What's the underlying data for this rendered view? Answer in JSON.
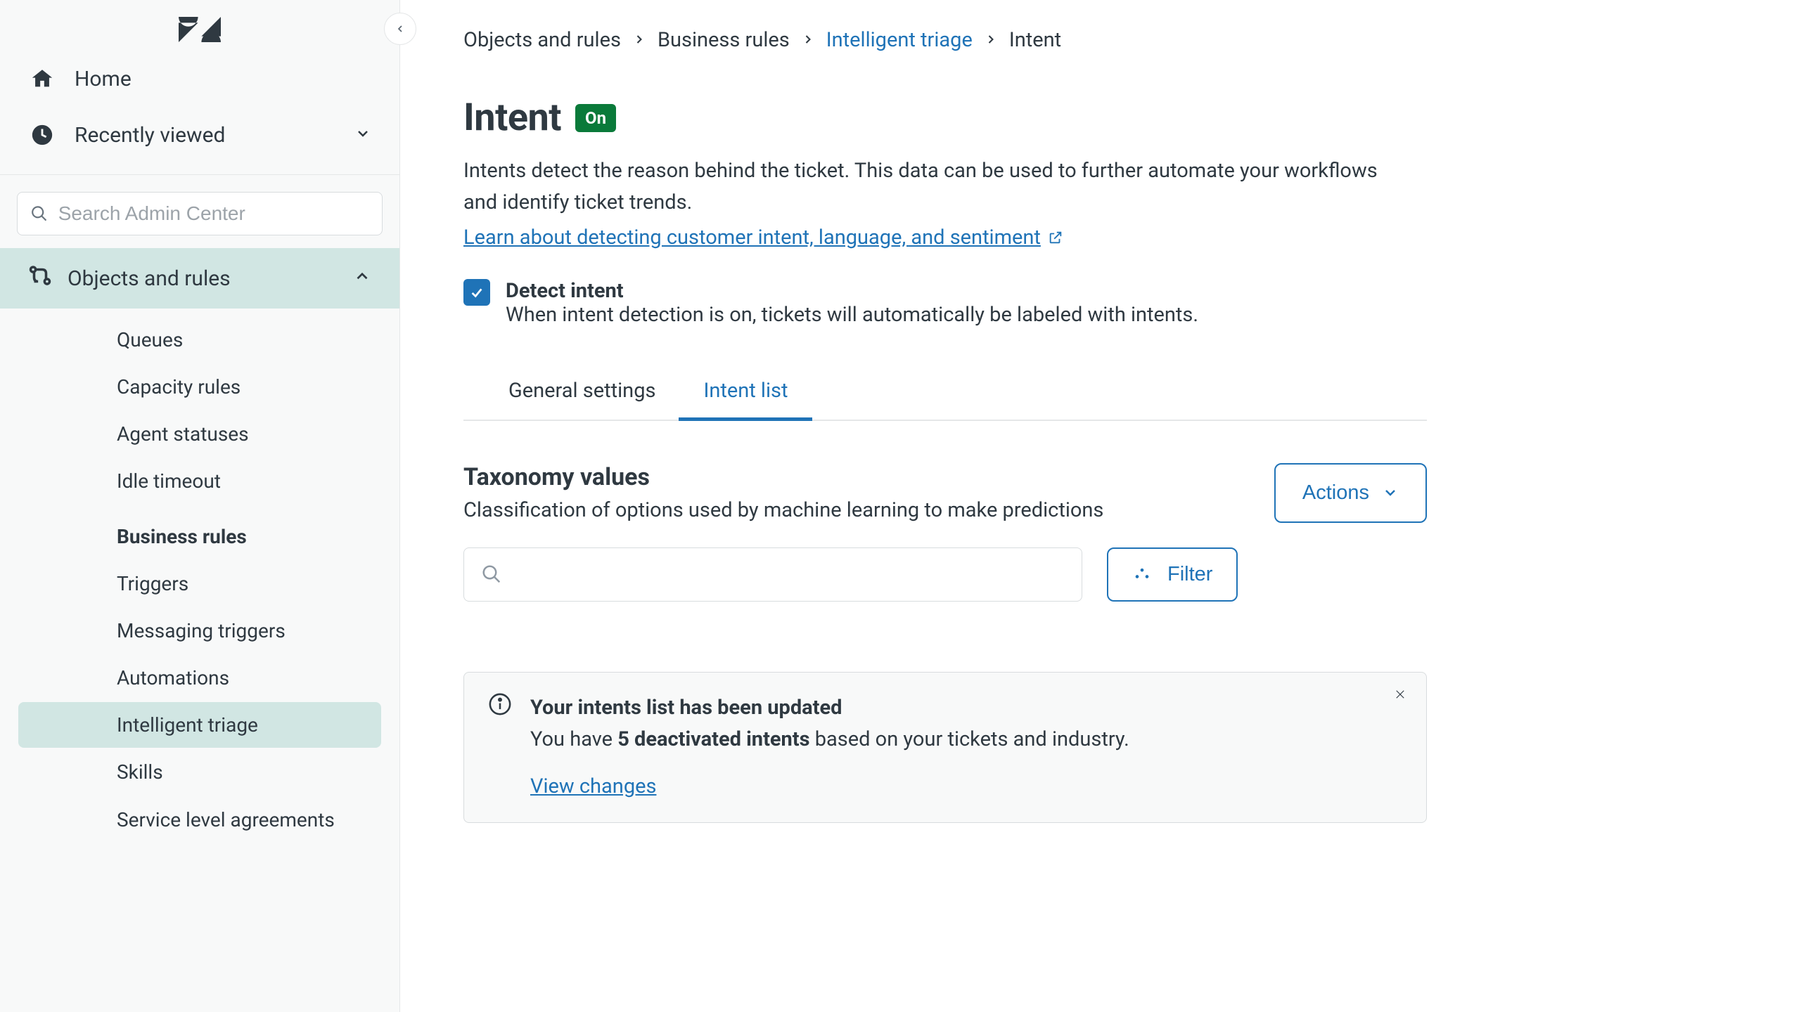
{
  "sidebar": {
    "home_label": "Home",
    "recent_label": "Recently viewed",
    "search_placeholder": "Search Admin Center",
    "section_label": "Objects and rules",
    "items": [
      {
        "label": "Queues"
      },
      {
        "label": "Capacity rules"
      },
      {
        "label": "Agent statuses"
      },
      {
        "label": "Idle timeout"
      }
    ],
    "group_header": "Business rules",
    "group_items": [
      {
        "label": "Triggers"
      },
      {
        "label": "Messaging triggers"
      },
      {
        "label": "Automations"
      },
      {
        "label": "Intelligent triage",
        "active": true
      },
      {
        "label": "Skills"
      },
      {
        "label": "Service level agreements"
      }
    ]
  },
  "breadcrumb": {
    "items": [
      "Objects and rules",
      "Business rules",
      "Intelligent triage",
      "Intent"
    ],
    "link_index": 2
  },
  "page": {
    "title": "Intent",
    "status": "On",
    "description": "Intents detect the reason behind the ticket. This data can be used to further automate your workflows and identify ticket trends.",
    "learn_link": "Learn about detecting customer intent, language, and sentiment"
  },
  "detect": {
    "label": "Detect intent",
    "sub": "When intent detection is on, tickets will automatically be labeled with intents.",
    "checked": true
  },
  "tabs": {
    "general": "General settings",
    "intent_list": "Intent list",
    "active": "intent_list"
  },
  "taxonomy": {
    "title": "Taxonomy values",
    "subtitle": "Classification of options used by machine learning to make predictions",
    "actions_label": "Actions",
    "filter_label": "Filter",
    "search_value": ""
  },
  "notice": {
    "title": "Your intents list has been updated",
    "pre": "You have ",
    "bold": "5 deactivated intents",
    "post": " based on your tickets and industry.",
    "view_changes": "View changes"
  }
}
